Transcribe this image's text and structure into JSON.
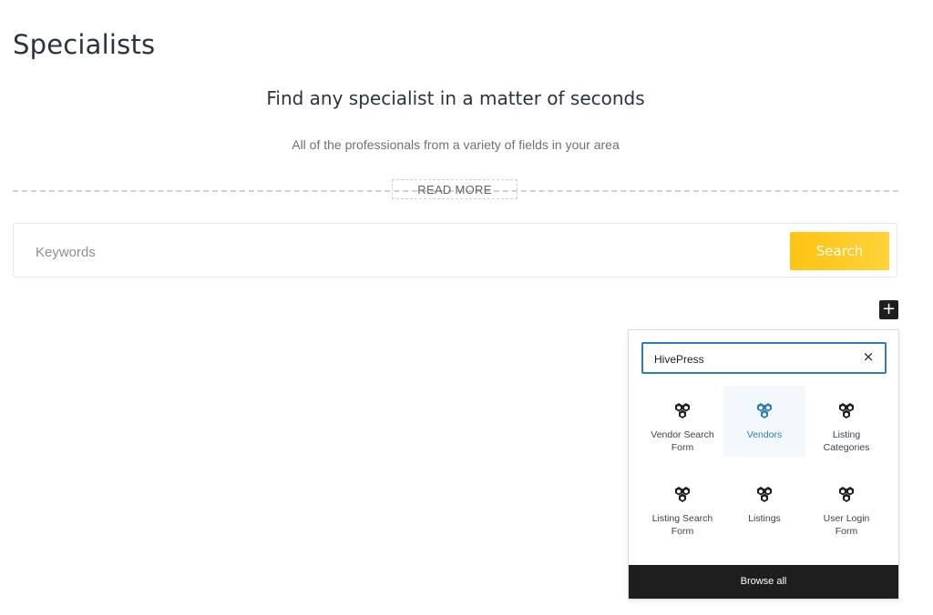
{
  "page": {
    "title": "Specialists",
    "headline": "Find any specialist in a matter of seconds",
    "subheadline": "All of the professionals from a variety of fields in your area",
    "read_more_label": "READ MORE"
  },
  "search": {
    "placeholder": "Keywords",
    "button_label": "Search",
    "button_color": "#ffc312"
  },
  "toolbar": {
    "add_block_label": "+"
  },
  "inserter": {
    "search_value": "HivePress",
    "clear_label": "×",
    "accent_color": "#2e7eb5",
    "blocks": [
      {
        "label": "Vendor Search Form",
        "icon": "hivepress-icon",
        "active": false
      },
      {
        "label": "Vendors",
        "icon": "hivepress-icon",
        "active": true
      },
      {
        "label": "Listing Categories",
        "icon": "hivepress-icon",
        "active": false
      },
      {
        "label": "Listing Search Form",
        "icon": "hivepress-icon",
        "active": false
      },
      {
        "label": "Listings",
        "icon": "hivepress-icon",
        "active": false
      },
      {
        "label": "User Login Form",
        "icon": "hivepress-icon",
        "active": false
      }
    ],
    "browse_all_label": "Browse all"
  }
}
